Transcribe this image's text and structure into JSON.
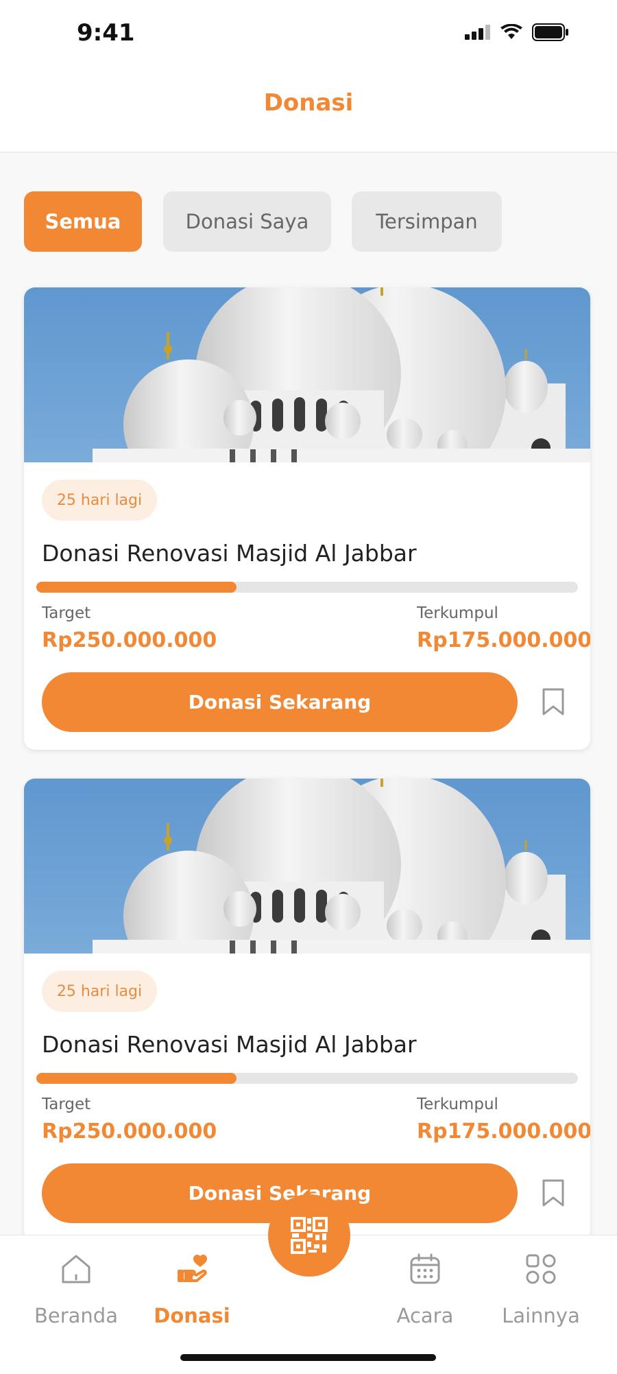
{
  "status_bar": {
    "time": "9:41"
  },
  "header": {
    "title": "Donasi"
  },
  "tabs": [
    {
      "label": "Semua",
      "active": true
    },
    {
      "label": "Donasi Saya",
      "active": false
    },
    {
      "label": "Tersimpan",
      "active": false
    }
  ],
  "cards": [
    {
      "badge": "25 hari lagi",
      "title": "Donasi Renovasi Masjid Al Jabbar",
      "progress_fraction": 0.37,
      "target_label": "Target",
      "target_value": "Rp250.000.000",
      "collected_label": "Terkumpul",
      "collected_value": "Rp175.000.000",
      "button_label": "Donasi Sekarang",
      "bookmark_icon": "bookmark-icon"
    },
    {
      "badge": "25 hari lagi",
      "title": "Donasi Renovasi Masjid Al Jabbar",
      "progress_fraction": 0.37,
      "target_label": "Target",
      "target_value": "Rp250.000.000",
      "collected_label": "Terkumpul",
      "collected_value": "Rp175.000.000",
      "button_label": "Donasi Sekarang",
      "bookmark_icon": "bookmark-icon"
    }
  ],
  "bottom_nav": {
    "items": [
      {
        "label": "Beranda",
        "icon": "home-icon",
        "active": false
      },
      {
        "label": "Donasi",
        "icon": "donation-hand-heart-icon",
        "active": true
      },
      {
        "label": "Acara",
        "icon": "calendar-icon",
        "active": false
      },
      {
        "label": "Lainnya",
        "icon": "grid-apps-icon",
        "active": false
      }
    ],
    "center_action_icon": "qr-code-icon"
  },
  "colors": {
    "accent": "#f28834",
    "badge_bg": "#fdeee2",
    "inactive_tab_bg": "#e8e8e8",
    "sky": "#6b9fd1"
  }
}
